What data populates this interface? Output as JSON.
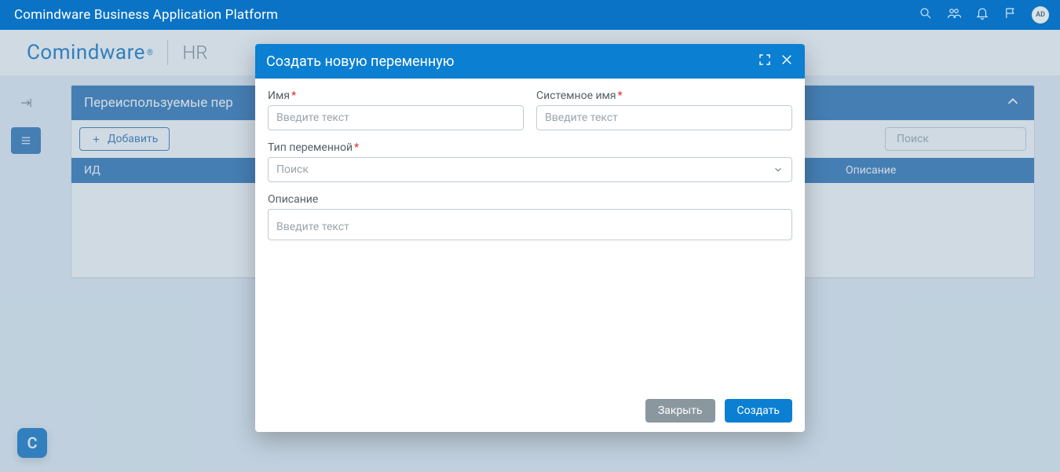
{
  "topbar": {
    "title": "Comindware Business Application Platform",
    "avatar": "AD"
  },
  "subheader": {
    "logo": "Comindware",
    "crumb": "HR"
  },
  "section": {
    "title": "Переиспользуемые пер",
    "add_label": "Добавить",
    "search_placeholder": "Поиск",
    "columns": {
      "id": "ИД",
      "desc": "Описание"
    }
  },
  "modal": {
    "title": "Создать новую переменную",
    "name_label": "Имя",
    "sysname_label": "Системное имя",
    "type_label": "Тип переменной",
    "desc_label": "Описание",
    "placeholder_text": "Введите текст",
    "placeholder_search": "Поиск",
    "btn_close": "Закрыть",
    "btn_create": "Создать"
  },
  "c_bubble": "C"
}
